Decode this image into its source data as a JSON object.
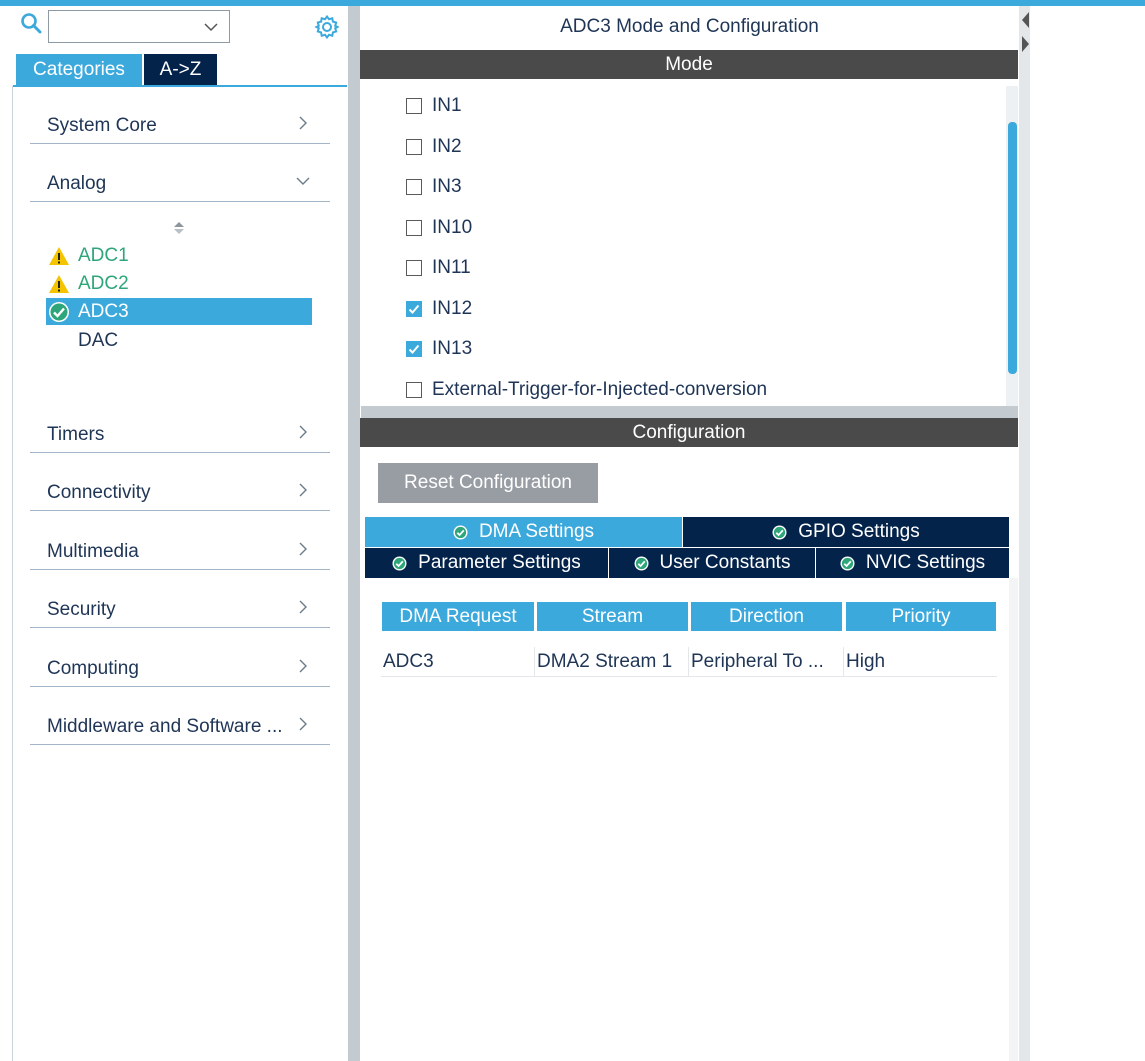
{
  "search": {
    "value": ""
  },
  "left_tabs": {
    "categories": "Categories",
    "az": "A->Z"
  },
  "categories": [
    {
      "label": "System Core",
      "expanded": false
    },
    {
      "label": "Analog",
      "expanded": true
    },
    {
      "label": "Timers",
      "expanded": false
    },
    {
      "label": "Connectivity",
      "expanded": false
    },
    {
      "label": "Multimedia",
      "expanded": false
    },
    {
      "label": "Security",
      "expanded": false
    },
    {
      "label": "Computing",
      "expanded": false
    },
    {
      "label": "Middleware and Software ...",
      "expanded": false
    }
  ],
  "analog_items": [
    {
      "label": "ADC1",
      "status": "warning"
    },
    {
      "label": "ADC2",
      "status": "warning"
    },
    {
      "label": "ADC3",
      "status": "ok",
      "selected": true
    },
    {
      "label": "DAC",
      "status": "none"
    }
  ],
  "panel_title": "ADC3 Mode and Configuration",
  "mode": {
    "header": "Mode",
    "channels": [
      {
        "label": "IN1",
        "checked": false
      },
      {
        "label": "IN2",
        "checked": false
      },
      {
        "label": "IN3",
        "checked": false
      },
      {
        "label": "IN10",
        "checked": false
      },
      {
        "label": "IN11",
        "checked": false
      },
      {
        "label": "IN12",
        "checked": true
      },
      {
        "label": "IN13",
        "checked": true
      },
      {
        "label": "External-Trigger-for-Injected-conversion",
        "checked": false
      }
    ]
  },
  "configuration": {
    "header": "Configuration",
    "reset_button": "Reset Configuration",
    "tabs": {
      "dma": "DMA Settings",
      "gpio": "GPIO Settings",
      "parameter": "Parameter Settings",
      "user_constants": "User Constants",
      "nvic": "NVIC Settings"
    },
    "active_tab": "DMA Settings"
  },
  "dma_table": {
    "headers": [
      "DMA Request",
      "Stream",
      "Direction",
      "Priority"
    ],
    "rows": [
      [
        "ADC3",
        "DMA2 Stream 1",
        "Peripheral To ...",
        "High"
      ]
    ]
  },
  "colors": {
    "accent": "#3ca9dd",
    "dark_navy": "#03234b",
    "header_gray": "#4a4a4a",
    "warning_text": "#2ea67a"
  }
}
